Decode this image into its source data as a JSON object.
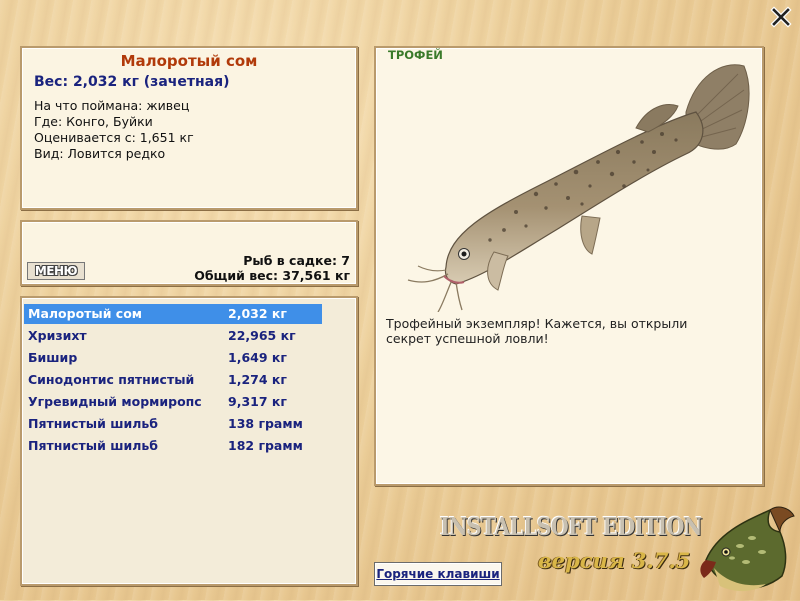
{
  "fish_info": {
    "name": "Малоротый сом",
    "weight": "Вес: 2,032 кг (зачетная)",
    "bait": "На что поймана: живец",
    "location": "Где: Конго, Буйки",
    "scored_from": "Оценивается с: 1,651 кг",
    "rarity": "Вид: Ловится редко"
  },
  "cage": {
    "menu_label": "МЕНЮ",
    "fish_count": "Рыб в садке: 7",
    "total_weight": "Общий вес: 37,561 кг"
  },
  "catch_list": [
    {
      "name": "Малоротый сом",
      "weight": "2,032 кг",
      "selected": true
    },
    {
      "name": "Хризихт",
      "weight": "22,965 кг"
    },
    {
      "name": "Бишир",
      "weight": "1,649 кг"
    },
    {
      "name": "Синодонтис пятнистый",
      "weight": "1,274 кг"
    },
    {
      "name": "Угревидный мормиропс",
      "weight": "9,317 кг"
    },
    {
      "name": "Пятнистый шильб",
      "weight": "138 грамм"
    },
    {
      "name": "Пятнистый шильб",
      "weight": "182 грамм"
    }
  ],
  "trophy": {
    "badge": "ТРОФЕЙ",
    "description": "Трофейный экземпляр! Кажется, вы открыли секрет успешной ловли!"
  },
  "footer": {
    "brand": "INSTALLSOFT EDITION",
    "version": "версия 3.7.5",
    "hotkeys_label": "Горячие клавиши"
  },
  "icons": {
    "close": "close-icon",
    "fish": "catfish-image",
    "pike": "pike-logo"
  }
}
